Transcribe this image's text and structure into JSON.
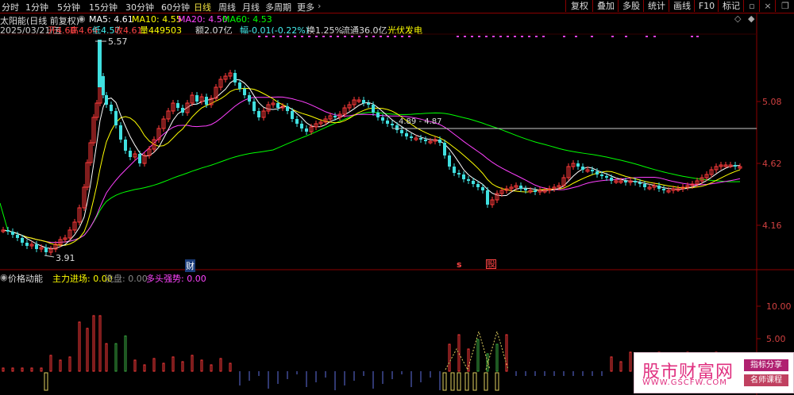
{
  "toolbar": {
    "tabs": [
      "分时",
      "1分钟",
      "5分钟",
      "15分钟",
      "30分钟",
      "60分钟",
      "日线",
      "周线",
      "月线",
      "多周期",
      "更多"
    ],
    "active_tab": 6,
    "right_buttons": [
      "复权",
      "叠加",
      "多股",
      "统计",
      "画线",
      "F10",
      "标记"
    ],
    "more_chevron": "›"
  },
  "info": {
    "title": "太阳能(日线 前复权)",
    "ma5": "MA5: 4.61",
    "ma10": "MA10: 4.55",
    "ma20": "MA20: 4.50",
    "ma60": "MA60: 4.53",
    "date": "2025/03/21/五",
    "open": "开4.60",
    "high": "高4.64",
    "low": "低4.57",
    "close": "收4.61",
    "volume": "量449503",
    "amount": "额2.07亿",
    "change": "幅-0.01(-0.22%)",
    "turnover": "换1.25%",
    "float": "流通36.0亿",
    "sector": "光伏发电"
  },
  "price_axis": [
    "5.08",
    "4.62",
    "4.16"
  ],
  "annotations": {
    "high_label": "5.57",
    "low_label": "3.91",
    "hline_label": "4.89 - 4.87"
  },
  "markers": {
    "cai": "财",
    "s": "s",
    "fa": "股"
  },
  "indicator": {
    "name": "价格动能",
    "main_label": "主力进场: 0.00",
    "wash_label": "洗盘: 0.00",
    "bull_label": "多头强势: 0.00",
    "axis": [
      "10.00",
      "5.00"
    ]
  },
  "watermark": {
    "cn": "股市财富网",
    "url": "WWW.GSCFW.COM",
    "tag1": "指标分享",
    "tag2": "名师课程"
  },
  "colors": {
    "up": "#ff3a3a",
    "down": "#40e0e0",
    "ma5": "#ffffff",
    "ma10": "#ffff00",
    "ma20": "#ff40ff",
    "ma60": "#00ff00"
  }
}
